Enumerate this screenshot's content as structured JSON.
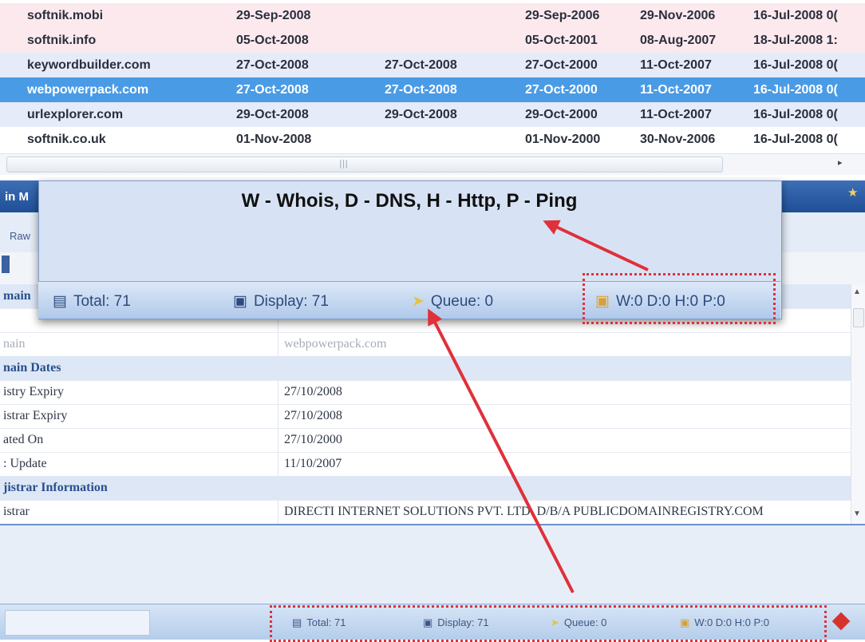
{
  "domain_grid": {
    "rows": [
      {
        "domain": "softnik.mobi",
        "c1": "29-Sep-2008",
        "c2": "",
        "c3": "29-Sep-2006",
        "c4": "29-Nov-2006",
        "c5": "16-Jul-2008 0("
      },
      {
        "domain": "softnik.info",
        "c1": "05-Oct-2008",
        "c2": "",
        "c3": "05-Oct-2001",
        "c4": "08-Aug-2007",
        "c5": "18-Jul-2008 1:"
      },
      {
        "domain": "keywordbuilder.com",
        "c1": "27-Oct-2008",
        "c2": "27-Oct-2008",
        "c3": "27-Oct-2000",
        "c4": "11-Oct-2007",
        "c5": "16-Jul-2008 0("
      },
      {
        "domain": "webpowerpack.com",
        "c1": "27-Oct-2008",
        "c2": "27-Oct-2008",
        "c3": "27-Oct-2000",
        "c4": "11-Oct-2007",
        "c5": "16-Jul-2008 0("
      },
      {
        "domain": "urlexplorer.com",
        "c1": "29-Oct-2008",
        "c2": "29-Oct-2008",
        "c3": "29-Oct-2000",
        "c4": "11-Oct-2007",
        "c5": "16-Jul-2008 0("
      },
      {
        "domain": "softnik.co.uk",
        "c1": "01-Nov-2008",
        "c2": "",
        "c3": "01-Nov-2000",
        "c4": "30-Nov-2006",
        "c5": "16-Jul-2008 0("
      }
    ],
    "selected_index": 3
  },
  "details_panel": {
    "title_fragment": "in M",
    "tab_fragment": "Raw",
    "rows": [
      {
        "key": "main",
        "value": ""
      },
      {
        "key": "",
        "value": ""
      },
      {
        "key": "nain",
        "value": "webpowerpack.com"
      },
      {
        "key": "nain Dates",
        "value": ""
      },
      {
        "key": "istry Expiry",
        "value": "27/10/2008"
      },
      {
        "key": "istrar Expiry",
        "value": "27/10/2008"
      },
      {
        "key": "ated On",
        "value": "27/10/2000"
      },
      {
        "key": ": Update",
        "value": "11/10/2007"
      },
      {
        "key": "jistrar Information",
        "value": ""
      },
      {
        "key": "istrar",
        "value": "DIRECTI INTERNET SOLUTIONS PVT. LTD. D/B/A PUBLICDOMAINREGISTRY.COM"
      }
    ]
  },
  "popup": {
    "legend": "W - Whois, D - DNS, H - Http, P - Ping",
    "total": "Total: 71",
    "display": "Display: 71",
    "queue": "Queue: 0",
    "workers": "W:0 D:0 H:0 P:0"
  },
  "status_bar": {
    "total": "Total: 71",
    "display": "Display: 71",
    "queue": "Queue: 0",
    "workers": "W:0 D:0 H:0 P:0"
  },
  "icons": {
    "total": "list-icon",
    "display": "monitor-icon",
    "queue": "arrow-right-icon",
    "workers": "lock-icon",
    "pin": "pin-icon"
  },
  "colors": {
    "selected_row": "#4a9be5",
    "annotation_red": "#e0303a",
    "panel_header": "#2a5aa2"
  }
}
